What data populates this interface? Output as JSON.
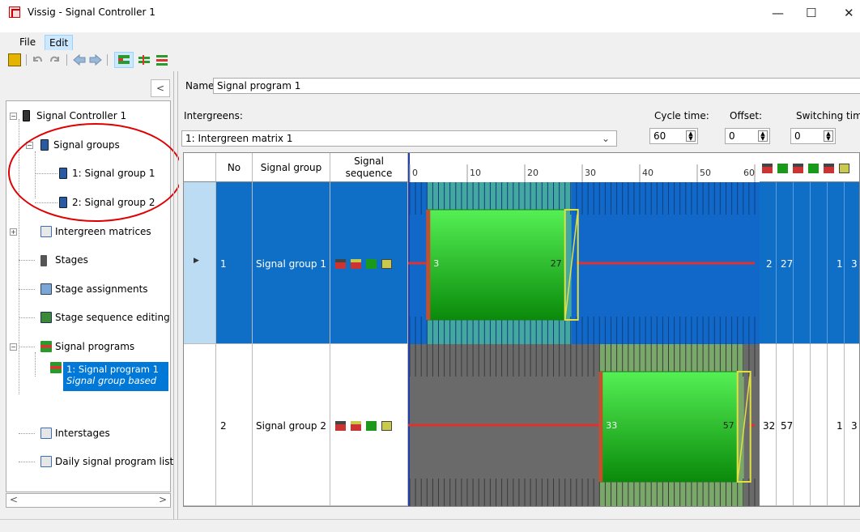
{
  "window": {
    "title": "Vissig - Signal Controller 1",
    "minimize": "—",
    "maximize": "☐",
    "close": "✕"
  },
  "menu": [
    {
      "label": "File"
    },
    {
      "label": "Edit"
    }
  ],
  "left_panel": {
    "collapse_glyph": "<",
    "tree": {
      "root": "Signal Controller 1",
      "signal_groups": "Signal groups",
      "sg1": "1: Signal group 1",
      "sg2": "2: Signal group 2",
      "intergreen_matrices": "Intergreen matrices",
      "stages": "Stages",
      "stage_assignments": "Stage assignments",
      "stage_sequence_editing": "Stage sequence editing",
      "signal_programs": "Signal programs",
      "sp1_line1": "1: Signal program 1",
      "sp1_line2": "Signal group based",
      "interstages": "Interstages",
      "daily_list": "Daily signal program list"
    },
    "scroll_left": "<",
    "scroll_right": ">"
  },
  "form": {
    "name_label": "Name:",
    "name_value": "Signal program 1",
    "intergreens_label": "Intergreens:",
    "intergreens_value": "1: Intergreen matrix 1",
    "cycle_label": "Cycle time:",
    "cycle_value": "60",
    "offset_label": "Offset:",
    "offset_value": "0",
    "switching_label": "Switching time",
    "switching_value": "0"
  },
  "grid": {
    "headers": {
      "no": "No",
      "signal_group": "Signal group",
      "signal_sequence_1": "Signal",
      "signal_sequence_2": "sequence"
    },
    "ticks": [
      0,
      10,
      20,
      30,
      40,
      50,
      60
    ],
    "cycle": 60,
    "rows": [
      {
        "no": "1",
        "name": "Signal group 1",
        "green_start": 3,
        "green_end": 27,
        "start_label": "3",
        "end_label": "27",
        "c1": "2",
        "c2": "27",
        "c3": "1",
        "c4": "3"
      },
      {
        "no": "2",
        "name": "Signal group 2",
        "green_start": 33,
        "green_end": 57,
        "start_label": "33",
        "end_label": "57",
        "c1": "32",
        "c2": "57",
        "c3": "1",
        "c4": "3"
      }
    ]
  },
  "colors": {
    "selection": "#0078d7",
    "row_selected": "#0f6fc6",
    "green": "#22c022",
    "red_line": "#e03030",
    "annotation": "#e00000"
  }
}
